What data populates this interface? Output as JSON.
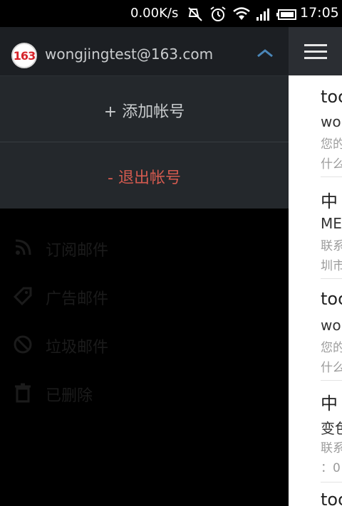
{
  "status_bar": {
    "network_speed": "0.00K/s",
    "time": "17:05",
    "icons": [
      "mute-icon",
      "alarm-icon",
      "wifi-icon",
      "signal-icon",
      "battery-icon"
    ]
  },
  "drawer": {
    "account_email": "wongjingtest@163.com",
    "logo_text": "163",
    "add_account": "+ 添加帐号",
    "logout": "- 退出帐号",
    "folders": [
      {
        "label": "订阅邮件",
        "icon": "subscribe-icon"
      },
      {
        "label": "广告邮件",
        "icon": "tag-icon"
      },
      {
        "label": "垃圾邮件",
        "icon": "spam-icon"
      },
      {
        "label": "已删除",
        "icon": "trash-icon"
      }
    ]
  },
  "mail_list": {
    "items": [
      {
        "subject": "toc",
        "sender": " wo",
        "preview": [
          "您的",
          "什么"
        ]
      },
      {
        "subject": "中",
        "sender": "ME",
        "preview": [
          "联系",
          "圳市"
        ]
      },
      {
        "subject": "toc",
        "sender": " wo",
        "preview": [
          "您的",
          "什么"
        ]
      },
      {
        "subject": "中",
        "sender": "变色",
        "preview": [
          "联系",
          "：0"
        ]
      },
      {
        "subject": "toc"
      }
    ]
  },
  "colors": {
    "accent_logout": "#d35a4f",
    "drawer_header": "#1c1f23",
    "drawer_panel": "#24282c",
    "toolbar": "#2b2e33"
  }
}
